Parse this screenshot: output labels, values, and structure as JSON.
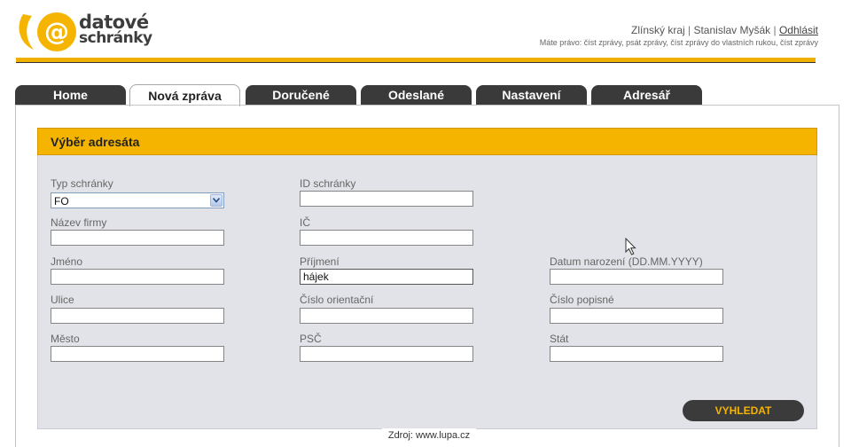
{
  "logo": {
    "symbol": "@",
    "line1": "datové",
    "line2": "schránky"
  },
  "user": {
    "region": "Zlínský kraj",
    "name": "Stanislav Myšák",
    "logout": "Odhlásit",
    "rights": "Máte právo: číst zprávy, psát zprávy, číst zprávy do vlastních rukou, číst zprávy"
  },
  "tabs": [
    {
      "label": "Home",
      "active": false
    },
    {
      "label": "Nová zpráva",
      "active": true
    },
    {
      "label": "Doručené",
      "active": false
    },
    {
      "label": "Odeslané",
      "active": false
    },
    {
      "label": "Nastavení",
      "active": false
    },
    {
      "label": "Adresář",
      "active": false
    }
  ],
  "section": {
    "title": "Výběr adresáta"
  },
  "form": {
    "typ_schranky": {
      "label": "Typ schránky",
      "value": "FO"
    },
    "id_schranky": {
      "label": "ID schránky",
      "value": ""
    },
    "nazev_firmy": {
      "label": "Název firmy",
      "value": ""
    },
    "ic": {
      "label": "IČ",
      "value": ""
    },
    "jmeno": {
      "label": "Jméno",
      "value": ""
    },
    "prijmeni": {
      "label": "Příjmení",
      "value": "hájek"
    },
    "datum_narozeni": {
      "label": "Datum narození (DD.MM.YYYY)",
      "value": ""
    },
    "ulice": {
      "label": "Ulice",
      "value": ""
    },
    "cislo_orientacni": {
      "label": "Číslo orientační",
      "value": ""
    },
    "cislo_popisne": {
      "label": "Číslo popisné",
      "value": ""
    },
    "mesto": {
      "label": "Město",
      "value": ""
    },
    "psc": {
      "label": "PSČ",
      "value": ""
    },
    "stat": {
      "label": "Stát",
      "value": ""
    }
  },
  "search_button": {
    "label": "VYHLEDAT"
  },
  "source_note": "Zdroj: www.lupa.cz",
  "colors": {
    "accent": "#f4b400",
    "tab_dark": "#3a3a3a",
    "form_bg": "#e1e3e8"
  },
  "icons": {
    "select_arrow": "chevron-down-icon",
    "pointer": "mouse-cursor-icon"
  }
}
